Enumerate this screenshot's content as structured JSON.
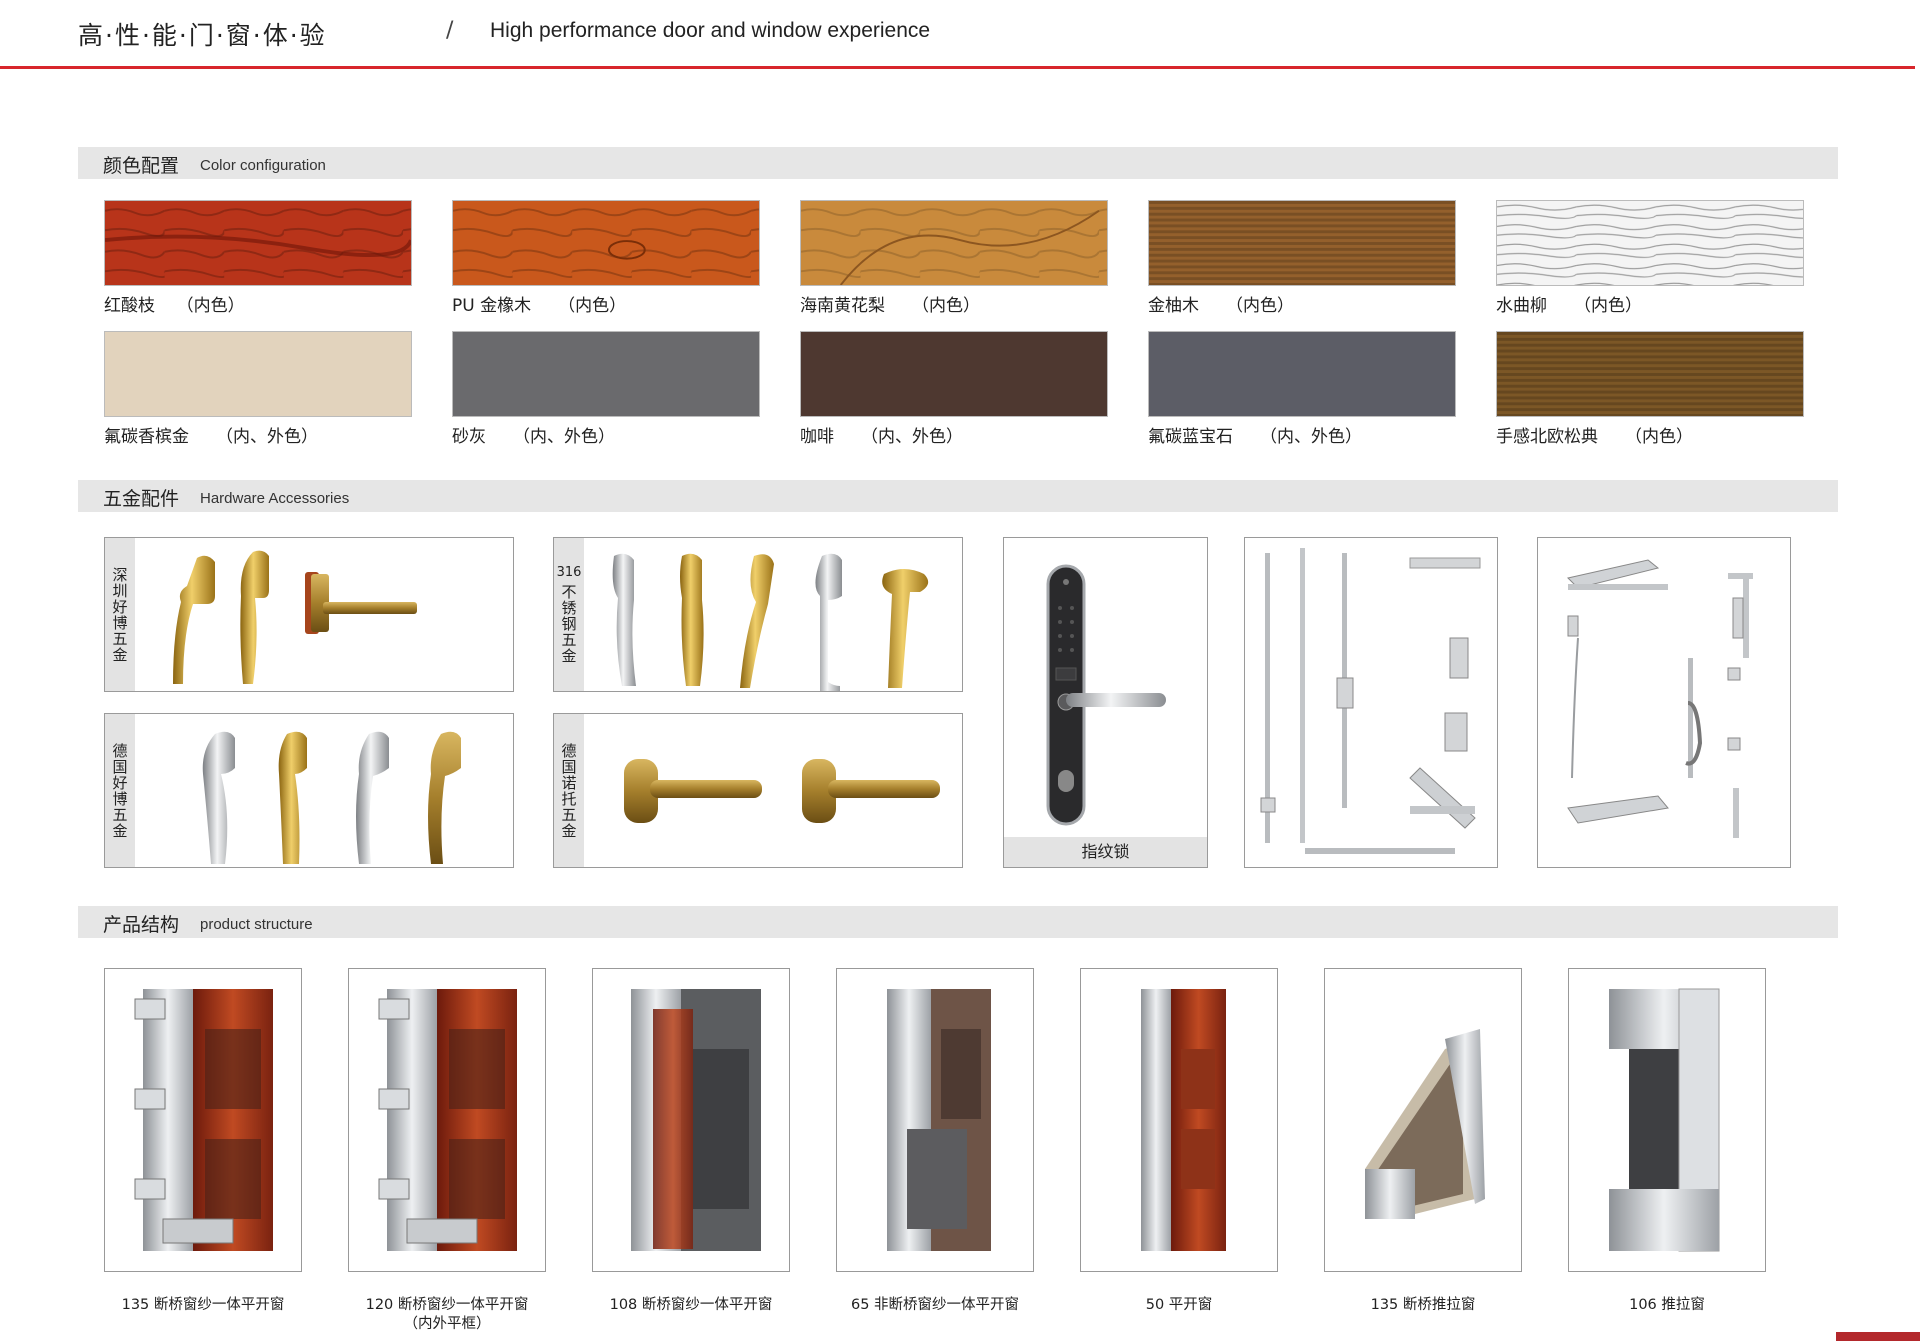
{
  "header": {
    "title_cn": "高·性·能·门·窗·体·验",
    "slash": "/",
    "title_en": "High performance door and window experience"
  },
  "sections": {
    "color": {
      "cn": "颜色配置",
      "en": "Color configuration"
    },
    "hardware": {
      "cn": "五金配件",
      "en": "Hardware Accessories"
    },
    "structure": {
      "cn": "产品结构",
      "en": "product structure"
    }
  },
  "swatches": [
    {
      "label": "红酸枝    （内色）",
      "color": "#b8341a"
    },
    {
      "label": "PU 金橡木     （内色）",
      "color": "#c9581c"
    },
    {
      "label": "海南黄花梨     （内色）",
      "color": "#c98a3c"
    },
    {
      "label": "金柚木     （内色）",
      "color": "#94602c"
    },
    {
      "label": "水曲柳     （内色）",
      "color": "#eeeeee"
    },
    {
      "label": "氟碳香槟金     （内、外色）",
      "color": "#e2d3bd"
    },
    {
      "label": "砂灰     （内、外色）",
      "color": "#6a6a6d"
    },
    {
      "label": "咖啡     （内、外色）",
      "color": "#4e3830"
    },
    {
      "label": "氟碳蓝宝石     （内、外色）",
      "color": "#5c5d66"
    },
    {
      "label": "手感北欧松典     （内色）",
      "color": "#7c5726"
    }
  ],
  "hardware": {
    "box1_label": "深圳好博五金",
    "box2_num": "316",
    "box2_label": "不锈钢五金",
    "box3_label": "德国好博五金",
    "box4_label": "德国诺托五金",
    "lock_caption": "指纹锁"
  },
  "products": [
    {
      "line1": "135 断桥窗纱一体平开窗",
      "line2": ""
    },
    {
      "line1": "120 断桥窗纱一体平开窗",
      "line2": "（内外平框）"
    },
    {
      "line1": "108 断桥窗纱一体平开窗",
      "line2": ""
    },
    {
      "line1": "65 非断桥窗纱一体平开窗",
      "line2": ""
    },
    {
      "line1": "50 平开窗",
      "line2": ""
    },
    {
      "line1": "135 断桥推拉窗",
      "line2": ""
    },
    {
      "line1": "106 推拉窗",
      "line2": ""
    }
  ],
  "colors": {
    "accent": "#d8262c",
    "section_bg": "#e6e6e6",
    "gold": "#c9a23c",
    "silver": "#c9cbcd"
  },
  "icons": [
    "window-handle-icon",
    "fingerprint-lock-icon",
    "lock-rod-icon",
    "hinge-icon",
    "window-profile-icon"
  ]
}
